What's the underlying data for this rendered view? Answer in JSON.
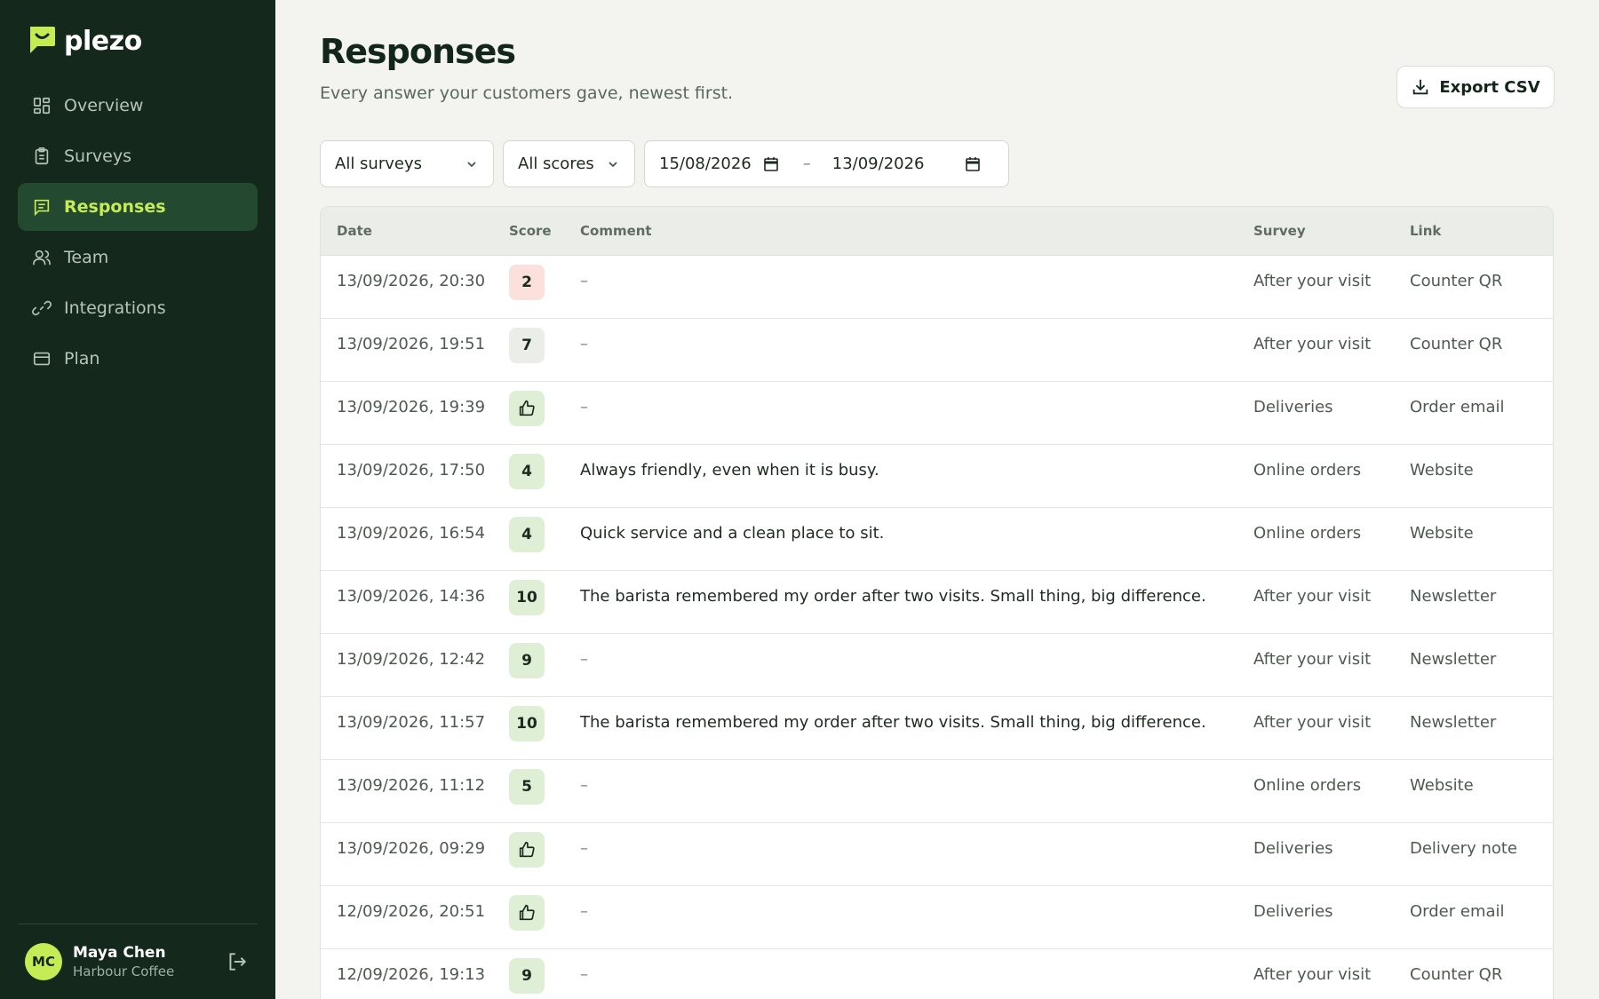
{
  "app": {
    "name": "plezo"
  },
  "nav": {
    "items": [
      {
        "label": "Overview",
        "icon": "grid-icon"
      },
      {
        "label": "Surveys",
        "icon": "clipboard-icon"
      },
      {
        "label": "Responses",
        "icon": "message-icon",
        "active": true
      },
      {
        "label": "Team",
        "icon": "users-icon"
      },
      {
        "label": "Integrations",
        "icon": "link-icon"
      },
      {
        "label": "Plan",
        "icon": "card-icon"
      }
    ]
  },
  "user": {
    "initials": "MC",
    "name": "Maya Chen",
    "org": "Harbour Coffee"
  },
  "page": {
    "title": "Responses",
    "subtitle": "Every answer your customers gave, newest first.",
    "export_label": "Export CSV"
  },
  "filters": {
    "survey": "All surveys",
    "score": "All scores",
    "date_from": "15/08/2026",
    "date_to": "13/09/2026",
    "separator": "–"
  },
  "table": {
    "headers": {
      "date": "Date",
      "score": "Score",
      "comment": "Comment",
      "survey": "Survey",
      "link": "Link"
    },
    "rows": [
      {
        "date": "13/09/2026, 20:30",
        "score": "2",
        "tone": "bad",
        "comment": "–",
        "survey": "After your visit",
        "link": "Counter QR"
      },
      {
        "date": "13/09/2026, 19:51",
        "score": "7",
        "tone": "mid",
        "comment": "–",
        "survey": "After your visit",
        "link": "Counter QR"
      },
      {
        "date": "13/09/2026, 19:39",
        "score": "thumbs-up-icon",
        "tone": "good",
        "comment": "–",
        "survey": "Deliveries",
        "link": "Order email"
      },
      {
        "date": "13/09/2026, 17:50",
        "score": "4",
        "tone": "good",
        "comment": "Always friendly, even when it is busy.",
        "survey": "Online orders",
        "link": "Website"
      },
      {
        "date": "13/09/2026, 16:54",
        "score": "4",
        "tone": "good",
        "comment": "Quick service and a clean place to sit.",
        "survey": "Online orders",
        "link": "Website"
      },
      {
        "date": "13/09/2026, 14:36",
        "score": "10",
        "tone": "good",
        "comment": "The barista remembered my order after two visits. Small thing, big difference.",
        "survey": "After your visit",
        "link": "Newsletter"
      },
      {
        "date": "13/09/2026, 12:42",
        "score": "9",
        "tone": "good",
        "comment": "–",
        "survey": "After your visit",
        "link": "Newsletter"
      },
      {
        "date": "13/09/2026, 11:57",
        "score": "10",
        "tone": "good",
        "comment": "The barista remembered my order after two visits. Small thing, big difference.",
        "survey": "After your visit",
        "link": "Newsletter"
      },
      {
        "date": "13/09/2026, 11:12",
        "score": "5",
        "tone": "good",
        "comment": "–",
        "survey": "Online orders",
        "link": "Website"
      },
      {
        "date": "13/09/2026, 09:29",
        "score": "thumbs-up-icon",
        "tone": "good",
        "comment": "–",
        "survey": "Deliveries",
        "link": "Delivery note"
      },
      {
        "date": "12/09/2026, 20:51",
        "score": "thumbs-up-icon",
        "tone": "good",
        "comment": "–",
        "survey": "Deliveries",
        "link": "Order email"
      },
      {
        "date": "12/09/2026, 19:13",
        "score": "9",
        "tone": "good",
        "comment": "–",
        "survey": "After your visit",
        "link": "Counter QR"
      }
    ]
  },
  "colors": {
    "sidebar": "#14291c",
    "accent": "#c5ec55",
    "score_bad": "#fbe0db",
    "score_mid": "#ebede8",
    "score_good": "#dfefd6"
  }
}
